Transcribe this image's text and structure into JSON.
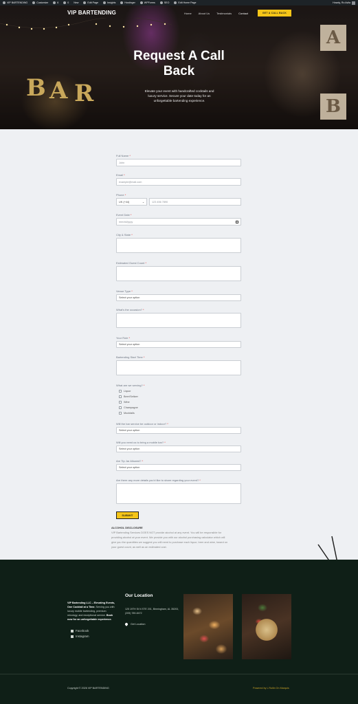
{
  "admin_bar": {
    "items": [
      "VIP BARTENDING",
      "Customize",
      "6",
      "0",
      "New",
      "Edit Page",
      "Insights",
      "Hostinger",
      "WPForms",
      "SEO",
      "Edit Home Page"
    ],
    "greeting": "Howdy, Ro Avila"
  },
  "header": {
    "logo": "VIP BARTENDING",
    "menu": [
      "Home",
      "About Us",
      "Testimonials",
      "Contact"
    ],
    "active_menu": "Contact",
    "cta": "GET A CALL BACK"
  },
  "hero": {
    "title": "Request A Call Back",
    "subtitle": "Elevate your event with handcrafted cocktails and luxury service. Secure your date today for an unforgettable bartending experience.",
    "bar_letters": [
      "B",
      "A",
      "R"
    ],
    "box_letters": [
      "A",
      "B"
    ]
  },
  "form": {
    "full_name": {
      "label": "Full Name",
      "placeholder": "John"
    },
    "email": {
      "label": "Email",
      "placeholder": "example@mail.com"
    },
    "phone": {
      "label": "Phone",
      "country": "UK (+44)",
      "placeholder": "123 456 7890"
    },
    "event_date": {
      "label": "Event Date",
      "placeholder": "mm/dd/yyyy"
    },
    "city_state": {
      "label": "City & State"
    },
    "guest_count": {
      "label": "Estimated Guest Count"
    },
    "venue_type": {
      "label": "Venue Type",
      "value": "Select your option"
    },
    "occasion": {
      "label": "What's the occasion?"
    },
    "role": {
      "label": "Your Role",
      "value": "Select your option"
    },
    "start_time": {
      "label": "Bartending Start Time"
    },
    "serving": {
      "label": "What are we serving?",
      "options": [
        "Liquor",
        "Beer/Seltzer",
        "Wine",
        "Champagne",
        "Mocktails"
      ]
    },
    "indoor_outdoor": {
      "label": "Will the bar service be outdoor or indoor?",
      "value": "Select your option"
    },
    "mobile_bar": {
      "label": "Will you need us to bring a mobile bar?",
      "value": "Select your option"
    },
    "tip": {
      "label": "Are Tip Jar Allowed?",
      "value": "Select your option"
    },
    "details": {
      "label": "Are there any more details you'd like to share regarding your event?"
    },
    "submit": "SUBMIT"
  },
  "disclosure": {
    "heading": "ALCOHOL DISCLOSURE",
    "text": "VIP Bartending Services DOES NOT provide alcohol at any event. You will be responsible for providing alcohol at your event. We provide you with our alcohol purchasing calculator which will give you the quantities we suggest you will need to purchase each liquor, beer and wine, based on your guest count, as well as an estimated cost."
  },
  "footer": {
    "about_bold": "VIP Bartending LLC – Elevating Events, One Cocktail at a Time.",
    "about_text": "Serving you with luxury mobile bartending, premium mixology, and exceptional service.",
    "about_cta": "Book now for an unforgettable experience.",
    "social": [
      "Facebook",
      "Instagram"
    ],
    "location_heading": "Our Location",
    "address": "125 19TH St N STE 201, Birmingham, AL 35203, (205) 789-8472",
    "get_location": "Get Location",
    "copyright": "Copyright © 2026 VIP BARTENDING",
    "powered": "Powered by L Rollin On Marquis"
  }
}
